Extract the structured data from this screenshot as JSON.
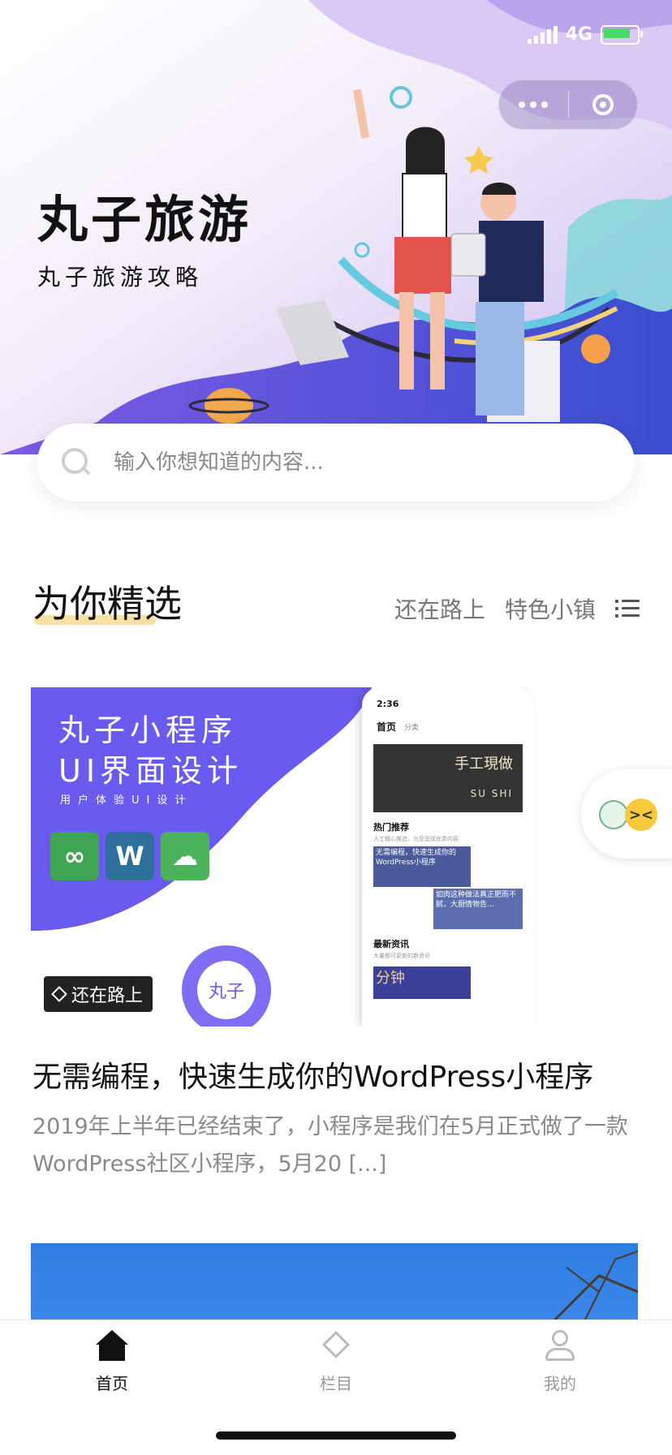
{
  "status": {
    "network": "4G"
  },
  "hero": {
    "title": "丸子旅游",
    "subtitle": "丸子旅游攻略"
  },
  "search": {
    "placeholder": "输入你想知道的内容..."
  },
  "section": {
    "title": "为你精选",
    "links": [
      "还在路上",
      "特色小镇"
    ]
  },
  "card": {
    "image": {
      "title_line1": "丸子小程序",
      "title_line2": "UI界面设计",
      "subtitle": "用户体验UI设计",
      "flower_label": "丸子",
      "phone": {
        "time": "2:36",
        "tab_active": "首页",
        "tab_other": "分类",
        "banner_line1": "手工現做",
        "banner_line2": "SU SHI",
        "section1": "热门推荐",
        "section1_sub": "人工精心推选，为您呈现优质内容",
        "block1": "无需编程，快速生成你的WordPress小程序",
        "block2": "如肉这种做法真正肥而不腻，大厨情物告...",
        "section2": "最新资讯",
        "section2_sub": "大量都可更新的新资讯",
        "block3": "分钟"
      }
    },
    "badge": "还在路上",
    "title": "无需编程，快速生成你的WordPress小程序",
    "excerpt": "  2019年上半年已经结束了，小程序是我们在5月正式做了一款WordPress社区小程序，5月20 [...]"
  },
  "tabbar": {
    "items": [
      {
        "label": "首页",
        "icon": "home-icon",
        "active": true
      },
      {
        "label": "栏目",
        "icon": "category-icon",
        "active": false
      },
      {
        "label": "我的",
        "icon": "user-icon",
        "active": false
      }
    ]
  },
  "colors": {
    "accent": "#6a5bf0",
    "underline": "#f4d98c"
  }
}
